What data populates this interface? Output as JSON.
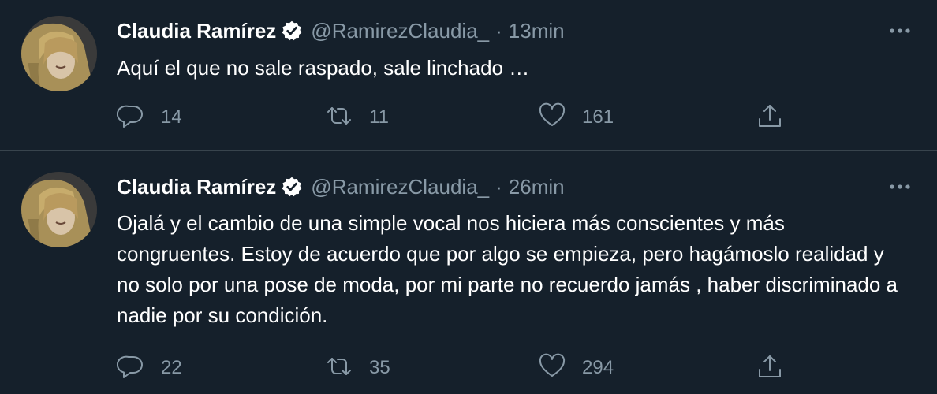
{
  "tweets": [
    {
      "author_name": "Claudia Ramírez",
      "handle": "@RamirezClaudia_",
      "separator": "·",
      "time": "13min",
      "text": "Aquí el que no sale raspado, sale linchado …",
      "replies": "14",
      "retweets": "11",
      "likes": "161"
    },
    {
      "author_name": "Claudia Ramírez",
      "handle": "@RamirezClaudia_",
      "separator": "·",
      "time": "26min",
      "text": "Ojalá y el cambio de una simple vocal nos hiciera más conscientes y más congruentes. Estoy de acuerdo que por algo se empieza, pero hagámoslo realidad y no solo por una pose de moda, por mi parte no recuerdo jamás , haber discriminado a nadie por su condición.",
      "replies": "22",
      "retweets": "35",
      "likes": "294"
    }
  ],
  "icons": {
    "verified": "verified-badge-icon",
    "more": "more-options-icon",
    "reply": "reply-icon",
    "retweet": "retweet-icon",
    "like": "heart-icon",
    "share": "share-icon"
  },
  "colors": {
    "background": "#15202b",
    "text_primary": "#ffffff",
    "text_secondary": "#8899a6",
    "divider": "#38444d"
  }
}
